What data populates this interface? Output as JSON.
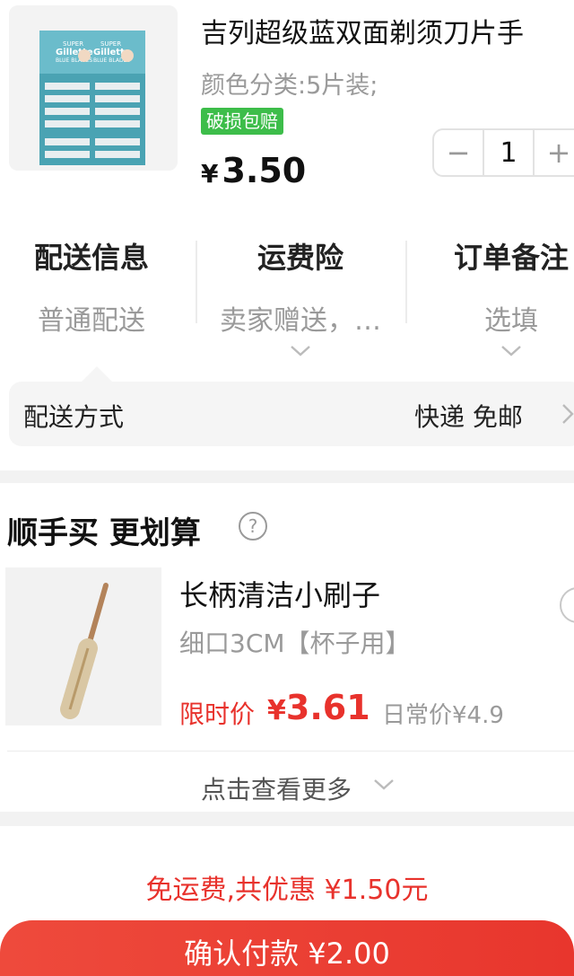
{
  "product": {
    "title": "吉列超级蓝双面剃须刀片手",
    "variant": "颜色分类:5片装;",
    "tag": "破损包赔",
    "price_symbol": "¥",
    "price": "3.50",
    "quantity": "1",
    "decrement": "−",
    "increment": "+",
    "package_text": {
      "brand": "Gillette",
      "line1": "SUPER",
      "line2": "BLUE BLADES"
    }
  },
  "options": [
    {
      "title": "配送信息",
      "value": "普通配送"
    },
    {
      "title": "运费险",
      "value": "卖家赠送，…"
    },
    {
      "title": "订单备注",
      "value": "选填"
    }
  ],
  "shipping": {
    "label": "配送方式",
    "value": "快递 免邮"
  },
  "recommend": {
    "title": "顺手买 更划算",
    "help": "?",
    "item": {
      "name": "长柄清洁小刷子",
      "spec": "细口3CM【杯子用】",
      "price_label": "限时价",
      "price_symbol": "¥",
      "price": "3.61",
      "original_price": "日常价¥4.9"
    },
    "more": "点击查看更多"
  },
  "footer": {
    "saving": "免运费,共优惠 ¥1.50元",
    "pay_button": "确认付款 ¥2.00"
  },
  "colors": {
    "accent_red": "#e8322c",
    "tag_green": "#3dbd4a"
  }
}
